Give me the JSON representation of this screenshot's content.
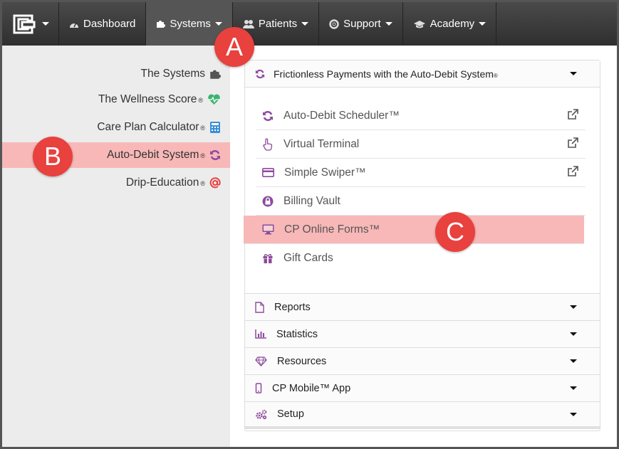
{
  "nav": {
    "items": [
      {
        "label": "Dashboard",
        "icon": "dashboard-icon"
      },
      {
        "label": "Systems",
        "icon": "puzzle-icon",
        "active": true
      },
      {
        "label": "Patients",
        "icon": "users-icon"
      },
      {
        "label": "Support",
        "icon": "lifebuoy-icon"
      },
      {
        "label": "Academy",
        "icon": "graduation-cap-icon"
      }
    ]
  },
  "sidebar": {
    "items": [
      {
        "label": "The Systems",
        "reg": "",
        "icon": "puzzle-icon"
      },
      {
        "label": "The Wellness Score",
        "reg": "®",
        "icon": "heartbeat-icon"
      },
      {
        "label": "Care Plan Calculator",
        "reg": "®",
        "icon": "calculator-icon"
      },
      {
        "label": "Auto-Debit System",
        "reg": "®",
        "icon": "refresh-icon",
        "selected": true
      },
      {
        "label": "Drip-Education",
        "reg": "®",
        "icon": "at-icon"
      }
    ]
  },
  "panel": {
    "title": "Frictionless Payments with the Auto-Debit System",
    "title_reg": "®",
    "sub_items": [
      {
        "label": "Auto-Debit Scheduler™",
        "icon": "refresh-icon",
        "external": true
      },
      {
        "label": "Virtual Terminal",
        "icon": "hand-pointer-icon",
        "external": true
      },
      {
        "label": "Simple Swiper™",
        "icon": "credit-card-icon",
        "external": true
      },
      {
        "label": "Billing Vault",
        "icon": "lock-icon",
        "external": false
      },
      {
        "label": "CP Online Forms™",
        "icon": "monitor-icon",
        "external": false,
        "highlight": true
      },
      {
        "label": "Gift Cards",
        "icon": "gift-icon",
        "external": false
      }
    ],
    "sections": [
      {
        "label": "Reports",
        "icon": "file-icon"
      },
      {
        "label": "Statistics",
        "icon": "bar-chart-icon"
      },
      {
        "label": "Resources",
        "icon": "diamond-icon"
      },
      {
        "label": "CP Mobile™ App",
        "icon": "mobile-icon"
      },
      {
        "label": "Setup",
        "icon": "gears-icon"
      }
    ]
  },
  "callouts": {
    "a": "A",
    "b": "B",
    "c": "C"
  },
  "colors": {
    "accent_purple": "#8e4a9e",
    "highlight": "#f8b8b8",
    "callout": "#e8413e",
    "heart_green": "#3cb46e",
    "calc_blue": "#3a8fd6",
    "at_red": "#e8413e"
  }
}
